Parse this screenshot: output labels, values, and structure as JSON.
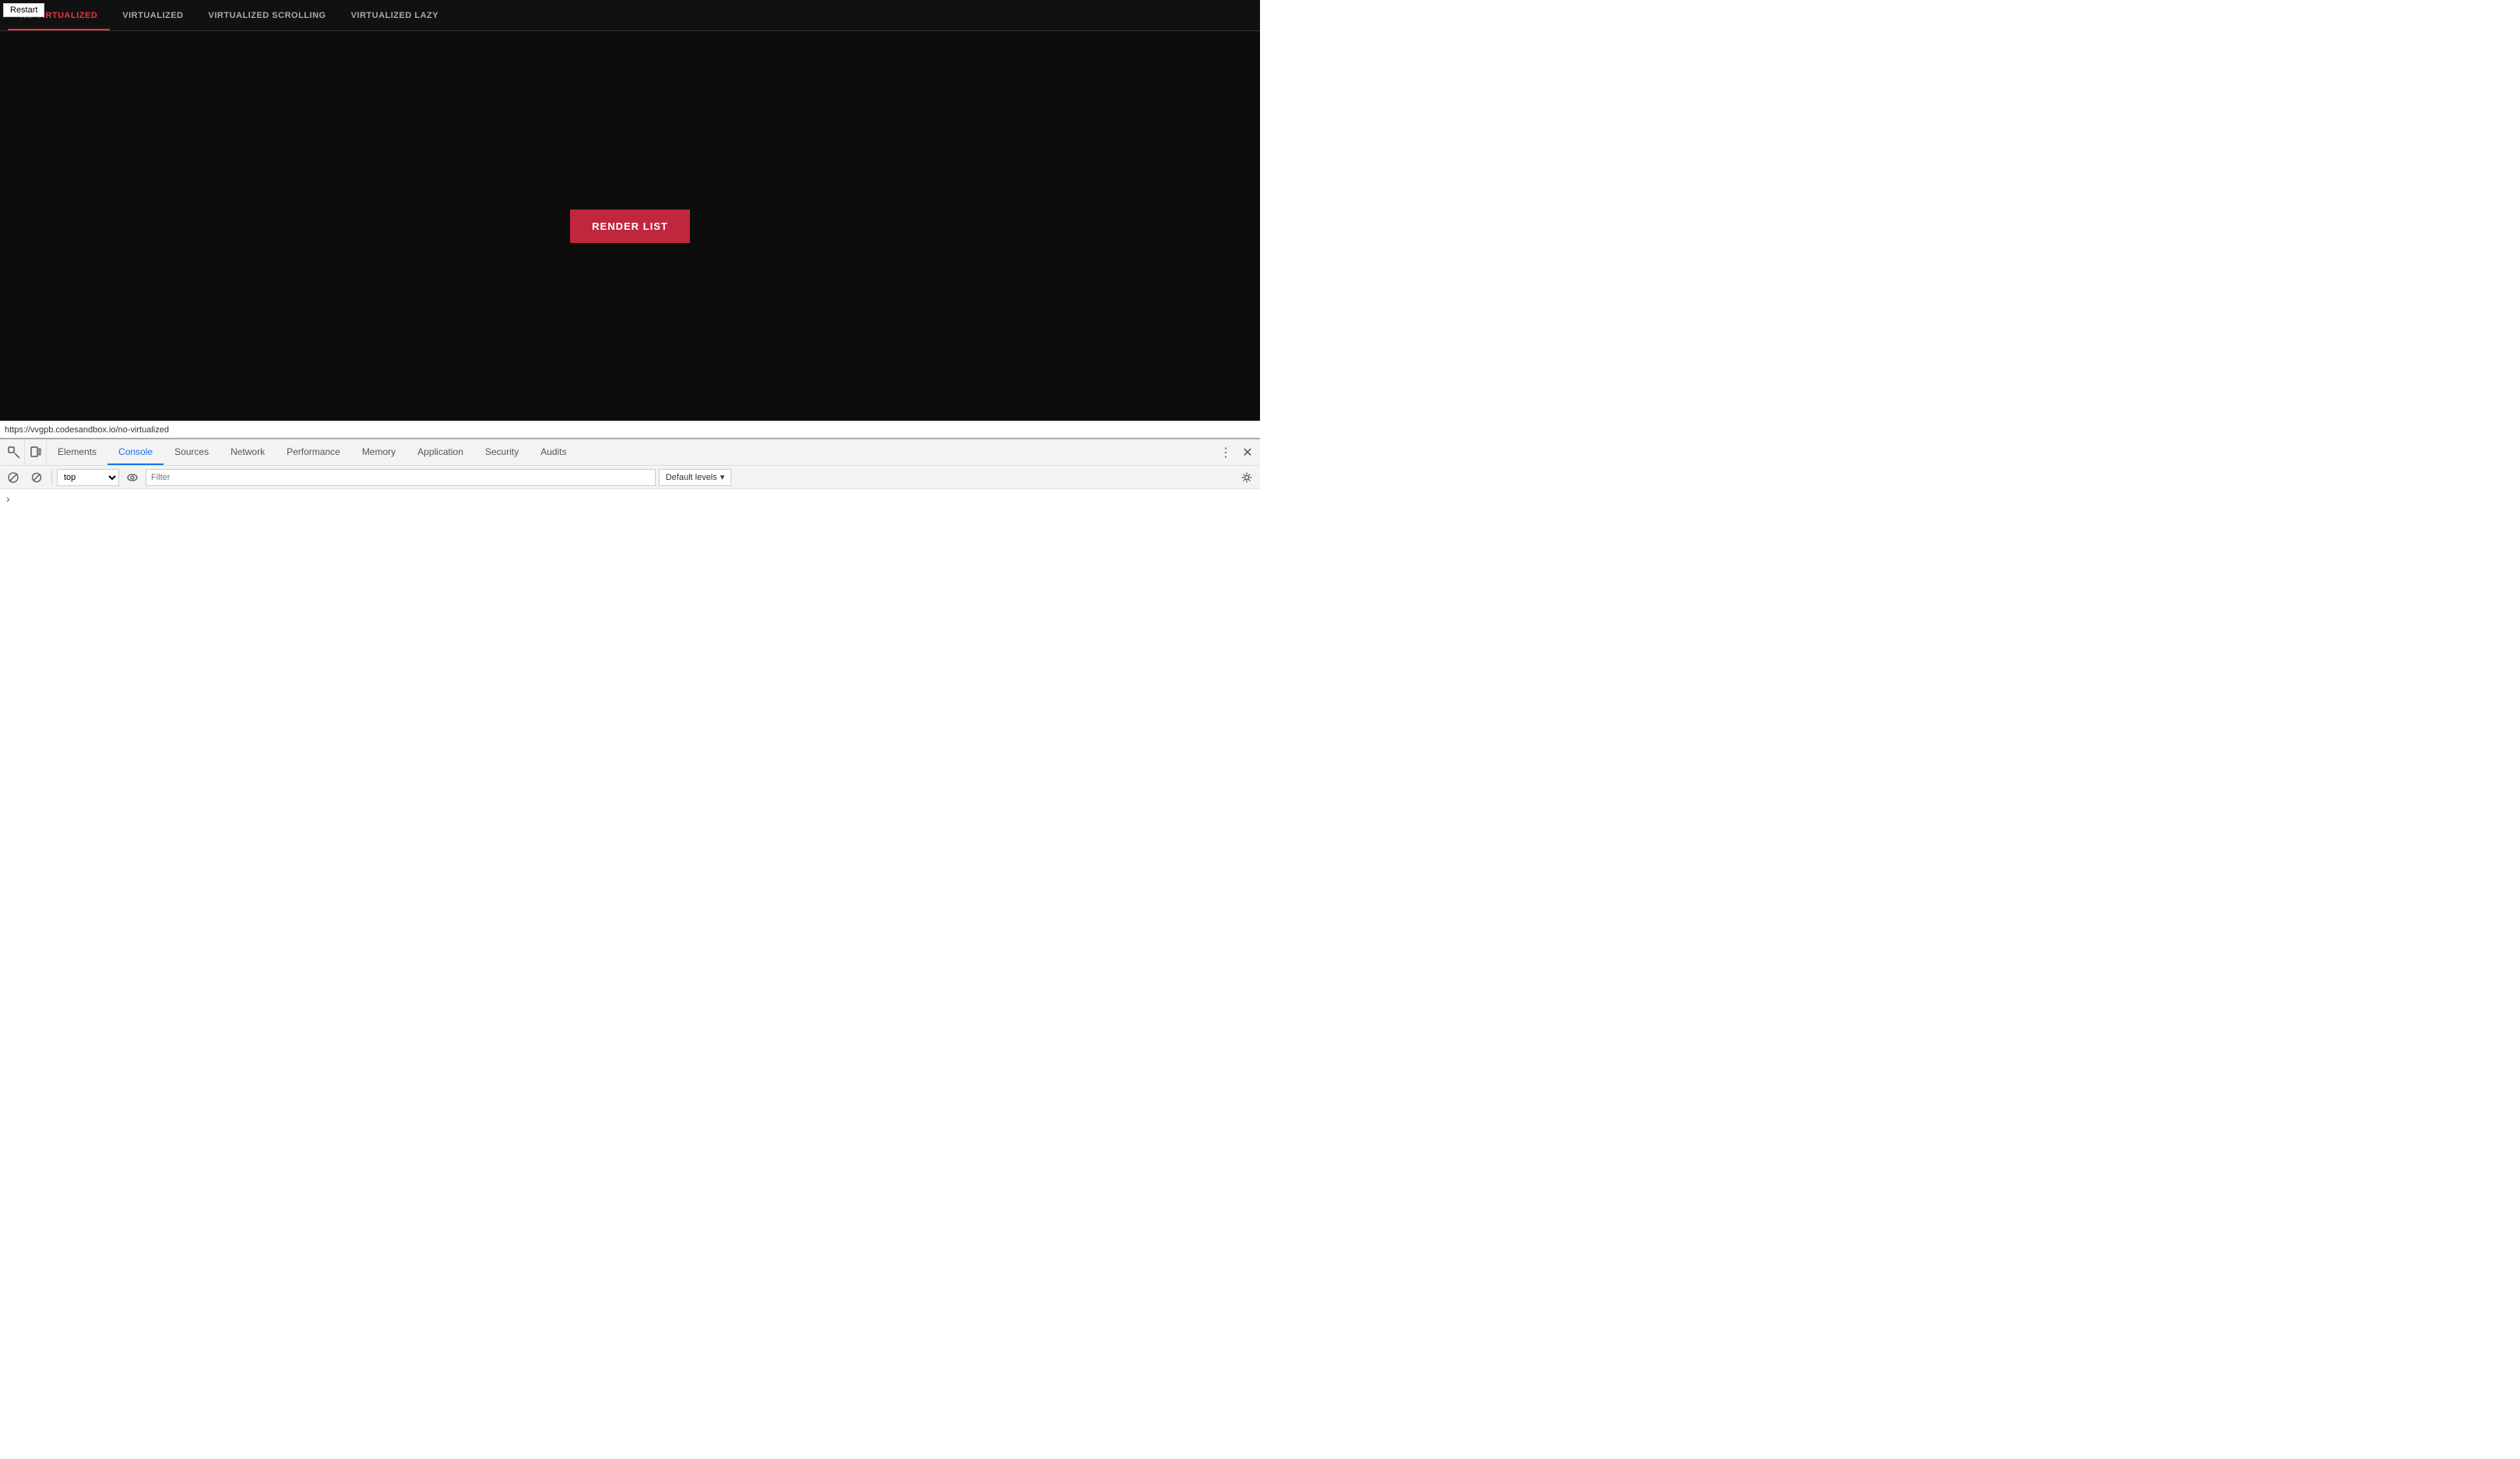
{
  "app": {
    "tabs": [
      {
        "id": "no-virtualized",
        "label": "NO VIRTUALIZED",
        "active": true
      },
      {
        "id": "virtualized",
        "label": "VIRTUALIZED",
        "active": false
      },
      {
        "id": "virtualized-scrolling",
        "label": "VIRTUALIZED SCROLLING",
        "active": false
      },
      {
        "id": "virtualized-lazy",
        "label": "VIRTUALIZED LAZY",
        "active": false
      }
    ],
    "render_button_label": "RENDER LIST",
    "restart_button_label": "Restart"
  },
  "status_bar": {
    "url": "https://vvgpb.codesandbox.io/no-virtualized"
  },
  "devtools": {
    "tabs": [
      {
        "id": "elements",
        "label": "Elements",
        "active": false
      },
      {
        "id": "console",
        "label": "Console",
        "active": true
      },
      {
        "id": "sources",
        "label": "Sources",
        "active": false
      },
      {
        "id": "network",
        "label": "Network",
        "active": false
      },
      {
        "id": "performance",
        "label": "Performance",
        "active": false
      },
      {
        "id": "memory",
        "label": "Memory",
        "active": false
      },
      {
        "id": "application",
        "label": "Application",
        "active": false
      },
      {
        "id": "security",
        "label": "Security",
        "active": false
      },
      {
        "id": "audits",
        "label": "Audits",
        "active": false
      }
    ],
    "console_toolbar": {
      "context_selector_value": "top",
      "filter_placeholder": "Filter",
      "default_levels_label": "Default levels"
    },
    "icons": {
      "inspect": "⬚",
      "device": "☐",
      "ban": "🚫",
      "clear": "⊘",
      "eye": "👁",
      "settings": "⚙",
      "more": "⋮",
      "close": "✕",
      "chevron_right": "›"
    }
  }
}
